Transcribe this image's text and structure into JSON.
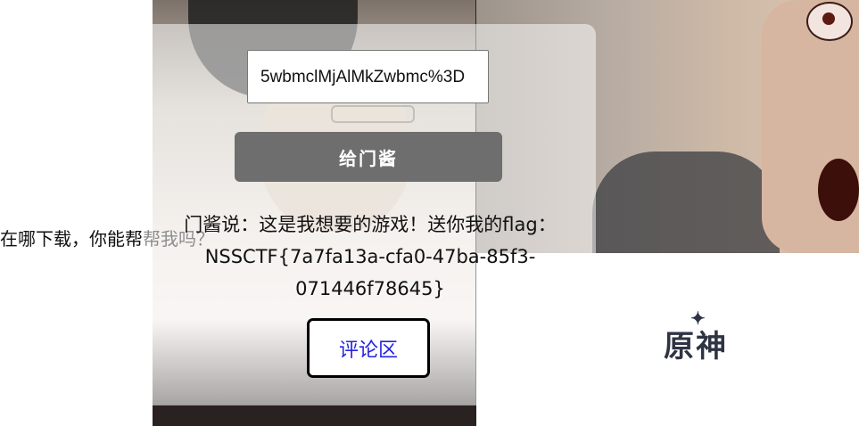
{
  "background": {
    "behind_text": "在哪下载，你能帮帮我吗？",
    "logo_text": "原神"
  },
  "form": {
    "input_value": "5wbmclMjAlMkZwbmc%3D",
    "submit_label": "给门酱"
  },
  "message": {
    "text": "门酱说：这是我想要的游戏！送你我的flag：NSSCTF{7a7fa13a-cfa0-47ba-85f3-071446f78645}"
  },
  "comment": {
    "label": "评论区"
  },
  "colors": {
    "button_bg": "#6e6e6e",
    "link_text": "#2424e0"
  }
}
